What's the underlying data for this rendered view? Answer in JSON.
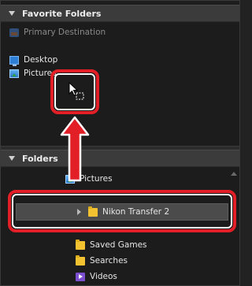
{
  "favorites": {
    "header": "Favorite Folders",
    "items": [
      {
        "label": "Primary Destination",
        "icon": "primary-destination-icon"
      },
      {
        "label": "Desktop",
        "icon": "desktop-icon"
      },
      {
        "label": "Pictures",
        "icon": "pictures-icon"
      }
    ]
  },
  "folders": {
    "header": "Folders",
    "items": [
      {
        "label": "Pictures",
        "icon": "pictures-icon"
      },
      {
        "label": "Nikon Transfer 2",
        "icon": "folder-icon"
      },
      {
        "label": "Saved Games",
        "icon": "folder-icon"
      },
      {
        "label": "Searches",
        "icon": "folder-icon"
      },
      {
        "label": "Videos",
        "icon": "videos-icon"
      }
    ]
  },
  "colors": {
    "accent_red": "#e21f26",
    "panel_bg": "#1c1c1c",
    "header_bg": "#3b3b3b"
  }
}
